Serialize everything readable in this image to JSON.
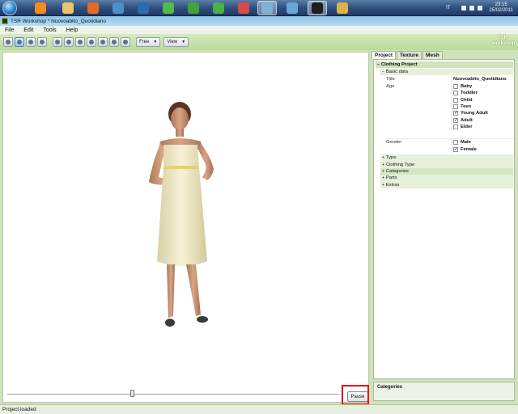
{
  "taskbar": {
    "icons": [
      {
        "name": "media-player-icon",
        "color": "#f28c1a"
      },
      {
        "name": "folder-icon",
        "color": "#e9c46a"
      },
      {
        "name": "firefox-icon",
        "color": "#e66a1f"
      },
      {
        "name": "network-icon",
        "color": "#4a90c8"
      },
      {
        "name": "photoshop-icon",
        "color": "#2b6cb0"
      },
      {
        "name": "sims-plumbob-icon",
        "color": "#54b948"
      },
      {
        "name": "sims-plumbob-alt-icon",
        "color": "#3fa43a"
      },
      {
        "name": "sims-green-icon",
        "color": "#49b04a"
      },
      {
        "name": "sims-red-icon",
        "color": "#d94a4a"
      },
      {
        "name": "users-icon",
        "color": "#7fb2d9"
      },
      {
        "name": "globe-icon",
        "color": "#6aa6d6"
      },
      {
        "name": "workshop-icon",
        "color": "#1f1f1f"
      },
      {
        "name": "paint-icon",
        "color": "#d8b64c"
      }
    ],
    "language": "IT",
    "time": "23:15",
    "date": "25/02/2011"
  },
  "window": {
    "title": "TSR Workshop * Nuovoabito_Quotidiano"
  },
  "menu": {
    "items": [
      "File",
      "Edit",
      "Tools",
      "Help"
    ]
  },
  "toolbar": {
    "mode_dropdown": "Free",
    "view_dropdown": "View",
    "logo_line1": "TSR",
    "logo_line2": "workshop"
  },
  "viewport": {
    "pause_label": "Pause",
    "timeline_position": 0.38
  },
  "panel": {
    "tabs": [
      "Project",
      "Texture",
      "Mesh"
    ],
    "root": "Clothing Project",
    "basic_data": "Basic data",
    "title_label": "Title",
    "title_value": "Nuovoabito_Quotidiano",
    "age_label": "Age",
    "ages": [
      {
        "label": "Baby",
        "checked": false
      },
      {
        "label": "Toddler",
        "checked": false
      },
      {
        "label": "Child",
        "checked": false
      },
      {
        "label": "Teen",
        "checked": false
      },
      {
        "label": "Young Adult",
        "checked": true
      },
      {
        "label": "Adult",
        "checked": true
      },
      {
        "label": "Elder",
        "checked": false
      }
    ],
    "gender_label": "Gender",
    "genders": [
      {
        "label": "Male",
        "checked": false
      },
      {
        "label": "Female",
        "checked": true
      }
    ],
    "sections": [
      "Type",
      "Clothing Type",
      "Categories",
      "Parts",
      "Extras"
    ],
    "description_title": "Categories"
  },
  "status": {
    "text": "Project loaded"
  }
}
